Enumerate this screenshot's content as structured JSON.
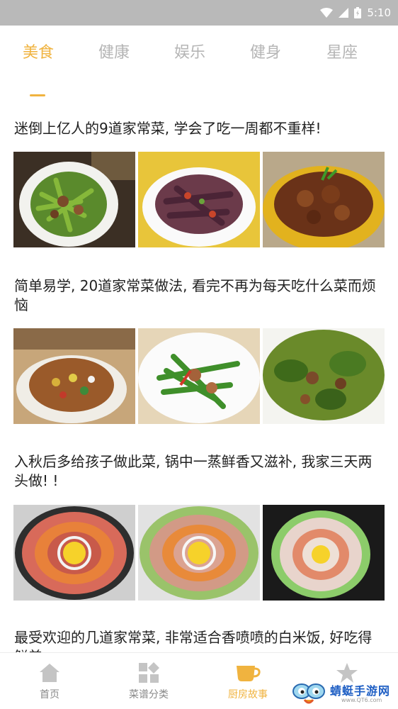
{
  "status_bar": {
    "time": "5:10"
  },
  "tabs": [
    {
      "label": "美食",
      "active": true
    },
    {
      "label": "健康",
      "active": false
    },
    {
      "label": "娱乐",
      "active": false
    },
    {
      "label": "健身",
      "active": false
    },
    {
      "label": "星座",
      "active": false
    }
  ],
  "articles": [
    {
      "title": "迷倒上亿人的9道家常菜, 学会了吃一周都不重样!"
    },
    {
      "title": "简单易学, 20道家常菜做法, 看完不再为每天吃什么菜而烦恼"
    },
    {
      "title": "入秋后多给孩子做此菜, 锅中一蒸鲜香又滋补, 我家三天两头做! !"
    },
    {
      "title": "最受欢迎的几道家常菜, 非常适合香喷喷的白米饭, 好吃得鲜美"
    }
  ],
  "bottom_nav": [
    {
      "label": "首页",
      "icon": "home-icon",
      "active": false
    },
    {
      "label": "菜谱分类",
      "icon": "grid-icon",
      "active": false
    },
    {
      "label": "厨房故事",
      "icon": "cup-icon",
      "active": true
    },
    {
      "label": "",
      "icon": "star-icon",
      "active": false
    }
  ],
  "watermark": {
    "name": "蜻蜓手游网",
    "url": "www.QT6.com"
  },
  "colors": {
    "accent": "#f0b33f",
    "inactive": "#b5b5b5",
    "status_bar": "#b9b9b9"
  }
}
